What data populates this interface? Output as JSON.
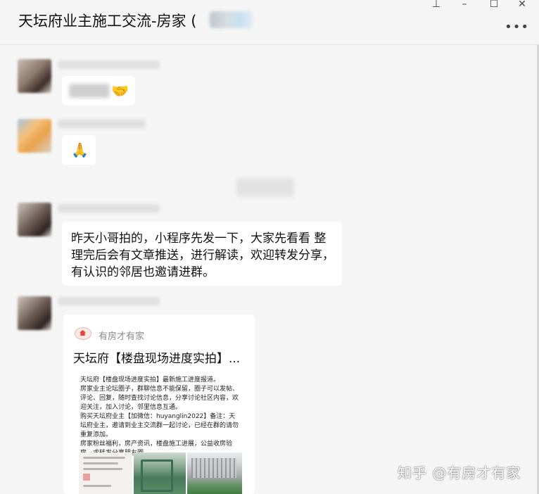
{
  "window": {
    "title": "天坛府业主施工交流-房家 (",
    "pin_icon": "pin-icon",
    "minimize_icon": "minimize-icon",
    "maximize_icon": "maximize-icon",
    "close_icon": "close-icon",
    "more_icon": "more-icon"
  },
  "messages": [
    {
      "type": "emoji",
      "emoji": "🤝",
      "emoji_name": "handshake-emoji"
    },
    {
      "type": "emoji",
      "emoji": "🙏",
      "emoji_name": "pray-emoji"
    },
    {
      "type": "text",
      "text": "昨天小哥拍的，小程序先发一下，大家先看看 整理完后会有文章推送，进行解读，欢迎转发分享，有认识的邻居也邀请进群。"
    },
    {
      "type": "link_card",
      "source": "有房才有家",
      "title": "天坛府【楼盘现场进度实拍】...",
      "description": "天坛府【楼盘现场进度实拍】最新施工进度报道。\n房家业主论坛圈子，群聊信息不能保留，圈子可以发帖、评论、回复，随时查找讨论信息，分享讨论社区内容，欢迎关注，加入讨论，邻里信息互通。\n购买天坛府业主【加微信：huyanglin2022】备注：天坛府业主，邀请到业主交流群一起讨论，已经在群的请勿重复添加。\n房家粉丝福利，房产资讯，楼盘施工进展，公益收房验房，求转发分享朋友圈。"
    }
  ],
  "watermark": "知乎 @有房才有家",
  "colors": {
    "background": "#f5f5f5",
    "bubble": "#ffffff"
  }
}
